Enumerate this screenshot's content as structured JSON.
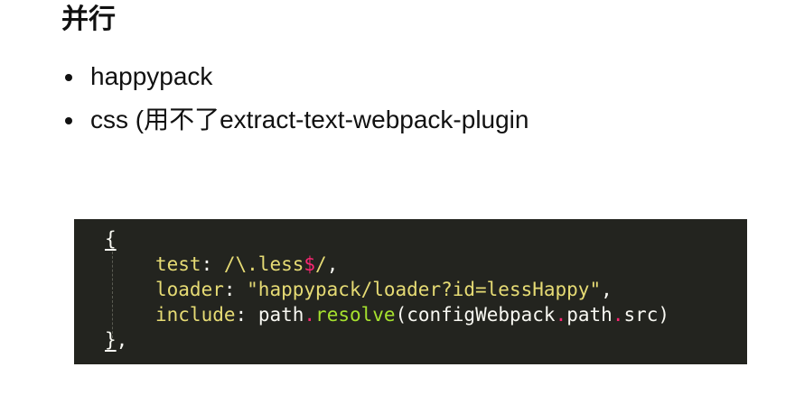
{
  "slide": {
    "title": "并行",
    "bullets": [
      {
        "text": "happypack"
      },
      {
        "text": "css (用不了extract-text-webpack-plugin"
      }
    ]
  },
  "code": {
    "open_brace": "{",
    "line1": {
      "key": "test",
      "colon": ": ",
      "regex_start": "/\\.less",
      "regex_dollar": "$",
      "regex_end": "/",
      "trail": ","
    },
    "line2": {
      "key": "loader",
      "colon": ": ",
      "value": "\"happypack/loader?id=lessHappy\"",
      "trail": ","
    },
    "line3": {
      "key": "include",
      "colon": ": ",
      "obj": "path",
      "dot1": ".",
      "method": "resolve",
      "args_start": "(configWebpack",
      "dot2": ".",
      "prop1": "path",
      "dot3": ".",
      "args_end": "src)"
    },
    "close_brace": "}",
    "close_trail": ","
  },
  "colors": {
    "code_background": "#23241f",
    "string_yellow": "#e6db74",
    "keyword_pink": "#f92672",
    "function_green": "#a6e22e",
    "plain_text": "#f8f8f2"
  }
}
